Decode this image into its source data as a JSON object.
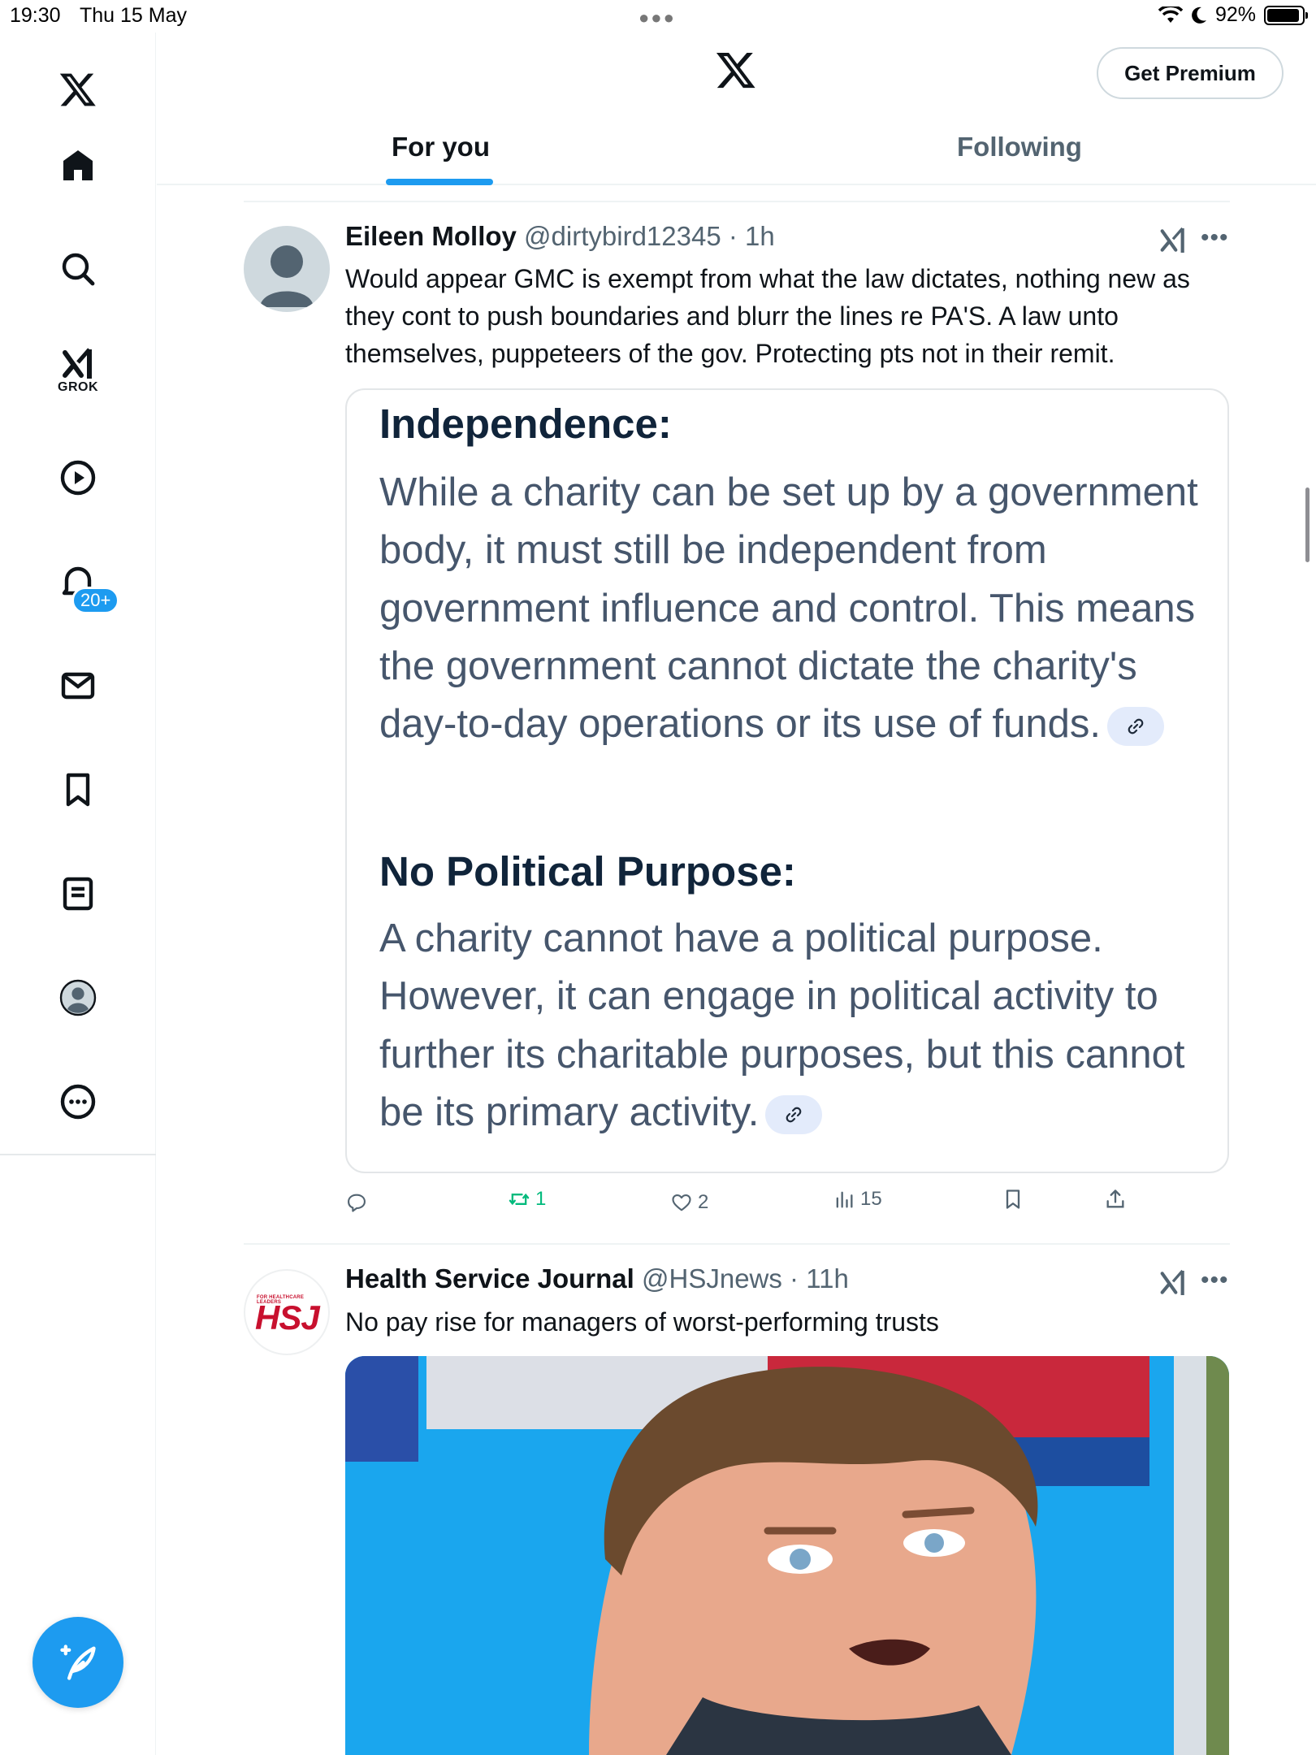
{
  "status_bar": {
    "time": "19:30",
    "date": "Thu 15 May",
    "battery": "92%",
    "battery_level": 0.92
  },
  "sidebar": {
    "grok_label": "GROK",
    "notifications_badge": "20+",
    "icons": [
      "x-logo-icon",
      "home-icon",
      "search-icon",
      "grok-icon",
      "video-icon",
      "notifications-icon",
      "messages-icon",
      "bookmarks-icon",
      "lists-icon",
      "profile-icon",
      "more-icon"
    ]
  },
  "header": {
    "premium_label": "Get Premium",
    "tabs": [
      {
        "label": "For you",
        "active": true
      },
      {
        "label": "Following",
        "active": false
      }
    ]
  },
  "posts": [
    {
      "name": "Eileen Molloy",
      "handle": "@dirtybird12345",
      "time": "1h",
      "text": "Would appear GMC is exempt from what the law dictates, nothing new as they cont to push boundaries and blurr the lines re PA'S. A law unto themselves, puppeteers of the gov. Protecting pts not in their remit.",
      "image": {
        "heading1": "Independence:",
        "body1": "While a charity can be set up by a government body, it must still be independent from government influence and control. This means the government cannot dictate the charity's day-to-day operations or its use of funds.",
        "heading2": "No Political Purpose:",
        "body2": "A charity cannot have a political purpose. However, it can engage in political activity to further its charitable purposes, but this cannot be its primary activity."
      },
      "stats": {
        "replies": "",
        "reposts": "1",
        "likes": "2",
        "views": "15"
      }
    },
    {
      "name": "Health Service Journal",
      "handle": "@HSJnews",
      "time": "11h",
      "text": "No pay rise for managers of worst-performing trusts",
      "avatar_text": "HSJ",
      "avatar_subtext": "FOR HEALTHCARE LEADERS"
    }
  ],
  "colors": {
    "accent": "#1d9bf0",
    "repost_green": "#00ba7c",
    "secondary_text": "#536471"
  }
}
